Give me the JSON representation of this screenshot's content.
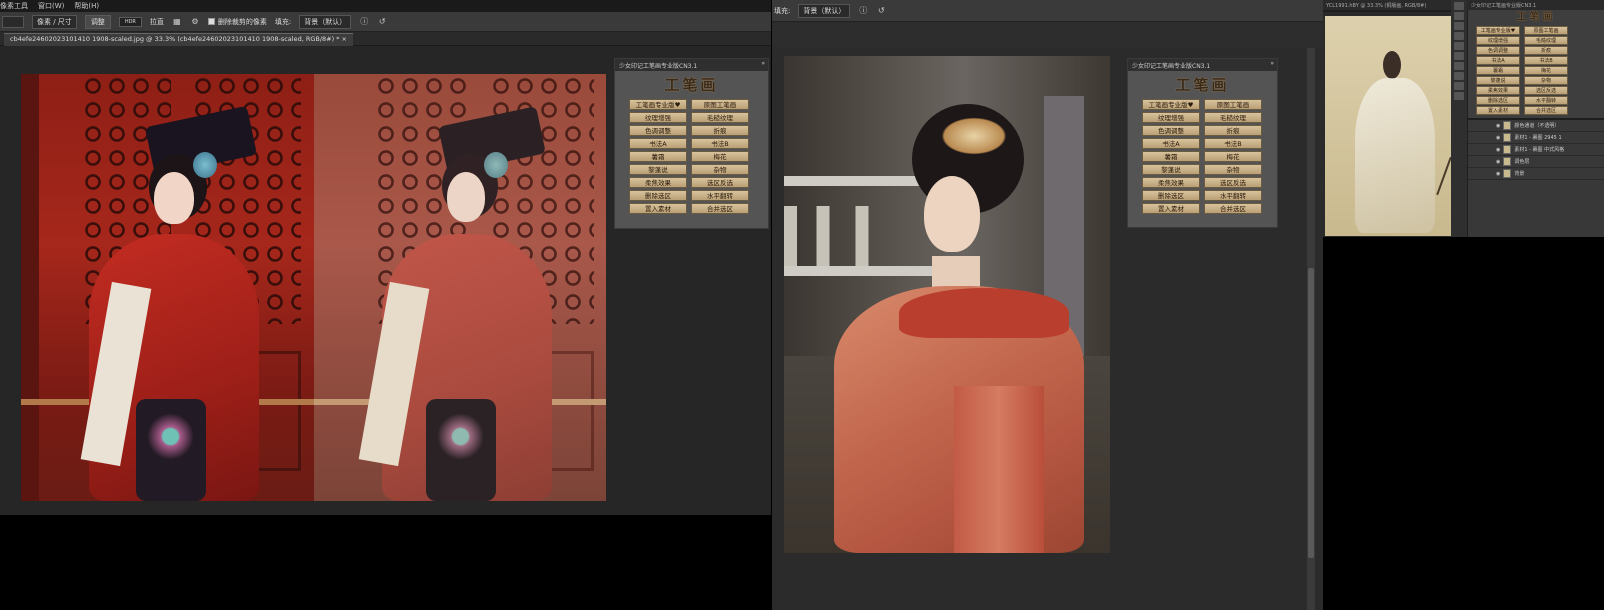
{
  "win1": {
    "menu": [
      "像素工具",
      "窗口(W)",
      "帮助(H)"
    ],
    "options": {
      "size_select": "像素 / 尺寸",
      "btn_blend": "调整",
      "btn_hdr": "HDR",
      "btn_pull": "拉直",
      "checkbox_delete_crop": "删除裁剪的像素",
      "fill_label": "填充:",
      "fill_value": "背景（默认）"
    },
    "doc_tab": "cb4efe24602023101410 1908-scaled.jpg @ 33.3% (cb4efe24602023101410 1908-scaled, RGB/8#) *  ×"
  },
  "win2": {
    "options": {
      "fill_label": "填充:",
      "fill_value": "背景（默认）"
    }
  },
  "plugin": {
    "title": "少女印记工笔画专业版CN3.1",
    "logo": "工笔画",
    "buttons": [
      "工笔画专业版♥",
      "原图工笔画",
      "纹理增强",
      "毛糙纹理",
      "色调调整",
      "折痕",
      "书法A",
      "书法B",
      "薯霜",
      "梅花",
      "黎蓬说",
      "杂物",
      "柔焦效果",
      "选区反选",
      "删除选区",
      "水平翻转",
      "置入素材",
      "合并选区"
    ]
  },
  "win3": {
    "title": "YCL1991.hBY @ 33.3% (铜版画, RGB/8#)",
    "panel_title": "少女印记工笔画专业版CN3.1",
    "logo": "工笔画",
    "buttons": [
      "工笔画专业版♥",
      "原图工笔画",
      "纹理增强",
      "毛糙纹理",
      "色调调整",
      "折痕",
      "书法A",
      "书法B",
      "薯霜",
      "梅花",
      "黎蓬说",
      "杂物",
      "柔焦效果",
      "选区反选",
      "删除选区",
      "水平翻转",
      "置入素材",
      "合并选区"
    ],
    "layers": [
      {
        "name": "颜色通道（不透明）"
      },
      {
        "name": "素材1 - 裹图 2945 1"
      },
      {
        "name": "素材1 - 裹图 中式风格"
      },
      {
        "name": "调色层"
      },
      {
        "name": "背景"
      }
    ]
  },
  "colors": {
    "ui_dark": "#282828",
    "panel_button": "#c9b28a",
    "red_dress": "#b32a1f"
  }
}
